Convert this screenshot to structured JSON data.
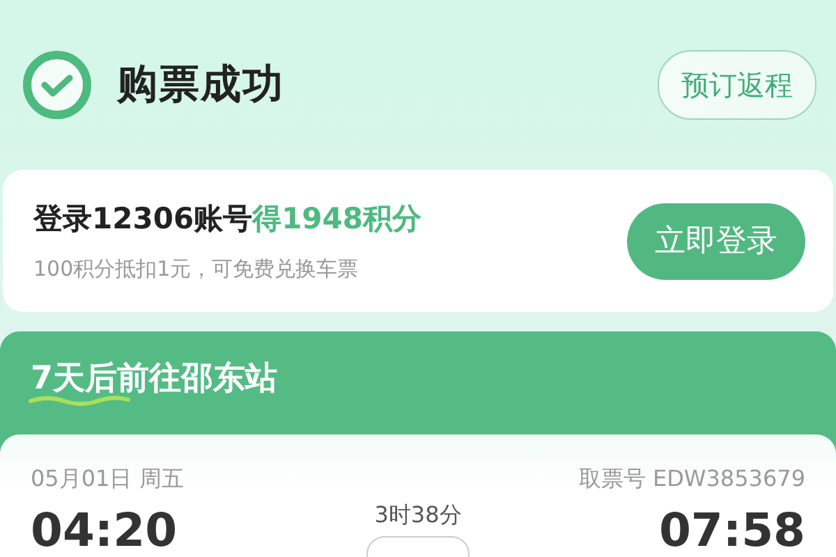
{
  "header": {
    "title": "购票成功",
    "return_button": "预订返程"
  },
  "login_card": {
    "title": "登录12306账号**得1948积分**",
    "subtitle": "100积分抵扣1元，可免费兑换车票",
    "button": "立即登录"
  },
  "trip": {
    "banner": "7天后前往邵东站",
    "date": "05月01日 周五",
    "ticket_no": "取票号 EDW3853679",
    "depart_time": "04:20",
    "duration": "3时38分",
    "arrive_time": "07:58"
  }
}
